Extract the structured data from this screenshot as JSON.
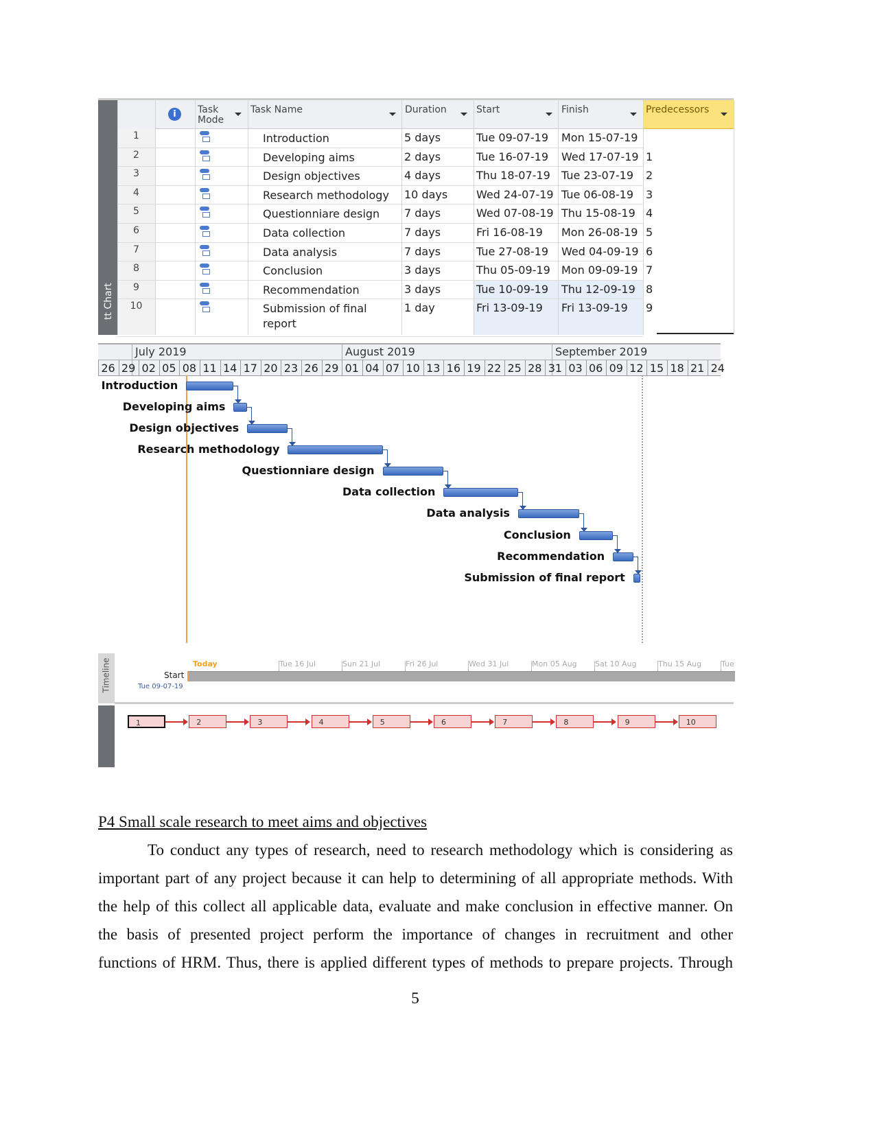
{
  "table": {
    "side_label": "tt Chart",
    "headers": {
      "task_mode": "Task Mode",
      "task_name": "Task Name",
      "duration": "Duration",
      "start": "Start",
      "finish": "Finish",
      "predecessors": "Predecessors"
    },
    "highlight_color": "#fbe27c",
    "rows": [
      {
        "id": "1",
        "name": "Introduction",
        "duration": "5 days",
        "start": "Tue 09-07-19",
        "finish": "Mon 15-07-19",
        "pred": ""
      },
      {
        "id": "2",
        "name": "Developing aims",
        "duration": "2 days",
        "start": "Tue 16-07-19",
        "finish": "Wed 17-07-19",
        "pred": "1"
      },
      {
        "id": "3",
        "name": "Design objectives",
        "duration": "4 days",
        "start": "Thu 18-07-19",
        "finish": "Tue 23-07-19",
        "pred": "2"
      },
      {
        "id": "4",
        "name": "Research methodology",
        "duration": "10 days",
        "start": "Wed 24-07-19",
        "finish": "Tue 06-08-19",
        "pred": "3"
      },
      {
        "id": "5",
        "name": "Questionniare design",
        "duration": "7 days",
        "start": "Wed 07-08-19",
        "finish": "Thu 15-08-19",
        "pred": "4"
      },
      {
        "id": "6",
        "name": "Data collection",
        "duration": "7 days",
        "start": "Fri 16-08-19",
        "finish": "Mon 26-08-19",
        "pred": "5"
      },
      {
        "id": "7",
        "name": "Data analysis",
        "duration": "7 days",
        "start": "Tue 27-08-19",
        "finish": "Wed 04-09-19",
        "pred": "6"
      },
      {
        "id": "8",
        "name": "Conclusion",
        "duration": "3 days",
        "start": "Thu 05-09-19",
        "finish": "Mon 09-09-19",
        "pred": "7"
      },
      {
        "id": "9",
        "name": "Recommendation",
        "duration": "3 days",
        "start": "Tue 10-09-19",
        "finish": "Thu 12-09-19",
        "pred": "8"
      },
      {
        "id": "10",
        "name": "Submission of final report",
        "duration": "1 day",
        "start": "Fri 13-09-19",
        "finish": "Fri 13-09-19",
        "pred": "9"
      }
    ]
  },
  "gantt": {
    "months": [
      "July 2019",
      "August 2019",
      "September 2019"
    ],
    "days": [
      "26",
      "29",
      "02",
      "05",
      "08",
      "11",
      "14",
      "17",
      "20",
      "23",
      "26",
      "29",
      "01",
      "04",
      "07",
      "10",
      "13",
      "16",
      "19",
      "22",
      "25",
      "28",
      "31",
      "03",
      "06",
      "09",
      "12",
      "15",
      "18",
      "21",
      "24"
    ],
    "labels": [
      "Introduction",
      "Developing aims",
      "Design objectives",
      "Research methodology",
      "Questionniare design",
      "Data collection",
      "Data analysis",
      "Conclusion",
      "Recommendation",
      "Submission of final report"
    ],
    "today_color": "#f0a050",
    "bar_color": "#4a7bcf"
  },
  "timeline": {
    "side_label": "Timeline",
    "today": "Today",
    "start_label": "Start",
    "start_date": "Tue 09-07-19",
    "ticks": [
      "Tue 16 Jul",
      "Sun 21 Jul",
      "Fri 26 Jul",
      "Wed 31 Jul",
      "Mon 05 Aug",
      "Sat 10 Aug",
      "Thu 15 Aug",
      "Tue"
    ]
  },
  "network": {
    "nodes": [
      "1",
      "2",
      "3",
      "4",
      "5",
      "6",
      "7",
      "8",
      "9",
      "10"
    ]
  },
  "document": {
    "heading": "P4 Small scale research to meet aims and objectives",
    "lines": [
      "To conduct any types of research, need to research methodology which is considering as",
      "important part of any project because it can help to determining of all appropriate methods. With",
      "the help of this collect all applicable data, evaluate and make conclusion in effective manner. On",
      "the basis of presented project perform the importance of changes in recruitment and other",
      "functions of HRM. Thus, there is applied different types of methods to prepare projects. Through"
    ],
    "page_number": "5"
  }
}
